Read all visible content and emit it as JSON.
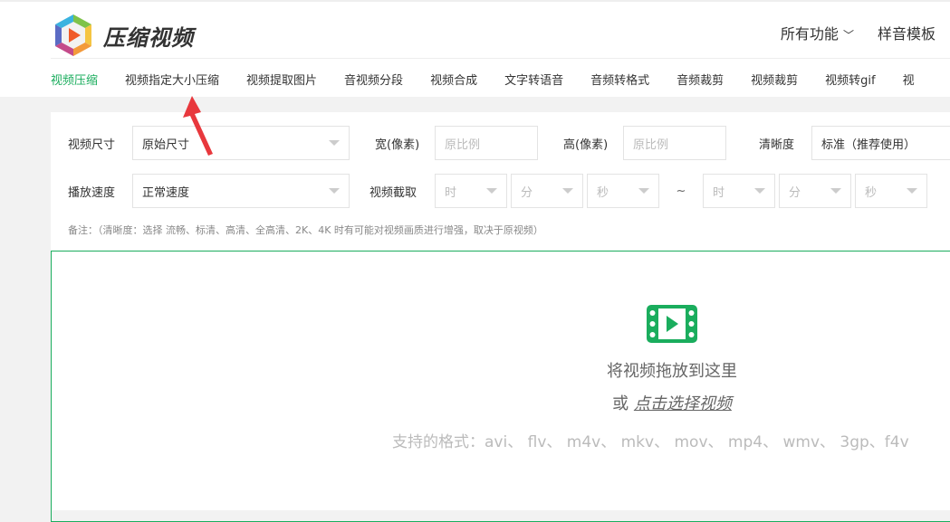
{
  "header": {
    "logo_text": "压缩视频",
    "links": [
      "所有功能",
      "样音模板"
    ]
  },
  "nav": [
    "视频压缩",
    "视频指定大小压缩",
    "视频提取图片",
    "音视频分段",
    "视频合成",
    "文字转语音",
    "音频转格式",
    "音频裁剪",
    "视频裁剪",
    "视频转gif",
    "视"
  ],
  "form": {
    "size_label": "视频尺寸",
    "size_value": "原始尺寸",
    "width_label": "宽(像素)",
    "width_placeholder": "原比例",
    "height_label": "高(像素)",
    "height_placeholder": "原比例",
    "quality_label": "清晰度",
    "quality_value": "标准（推荐使用）",
    "speed_label": "播放速度",
    "speed_value": "正常速度",
    "clip_label": "视频截取",
    "hour": "时",
    "minute": "分",
    "second": "秒",
    "tilde": "~",
    "note": "备注：（清晰度：选择 流畅、标清、高清、全高清、2K、4K 时有可能对视频画质进行增强，取决于原视频）"
  },
  "drop": {
    "title": "将视频拖放到这里",
    "or": "或",
    "select_link": "点击选择视频",
    "formats": "支持的格式：avi、 flv、 m4v、 mkv、 mov、 mp4、 wmv、 3gp、f4v"
  },
  "colors": {
    "accent": "#1aad5d",
    "arrow": "#e8383d"
  }
}
